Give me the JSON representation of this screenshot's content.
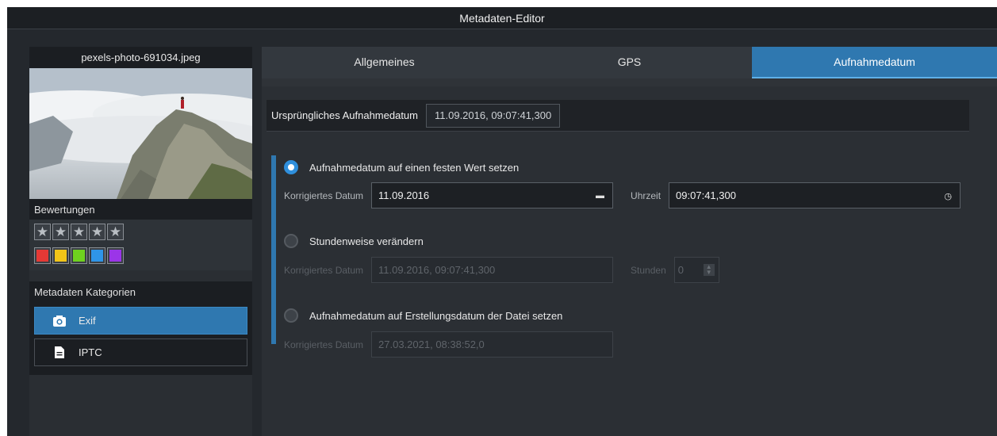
{
  "window": {
    "title": "Metadaten-Editor"
  },
  "left": {
    "filename": "pexels-photo-691034.jpeg",
    "ratings_label": "Bewertungen",
    "star_count": 5,
    "color_labels": [
      "#e53935",
      "#f2c518",
      "#6fd11f",
      "#2f95e8",
      "#9b35e8"
    ],
    "categories_label": "Metadaten Kategorien",
    "categories": [
      {
        "label": "Exif",
        "icon": "camera-icon",
        "active": true
      },
      {
        "label": "IPTC",
        "icon": "document-icon",
        "active": false
      }
    ]
  },
  "tabs": [
    {
      "label": "Allgemeines",
      "active": false
    },
    {
      "label": "GPS",
      "active": false
    },
    {
      "label": "Aufnahmedatum",
      "active": true
    }
  ],
  "original": {
    "label": "Ursprüngliches Aufnahmedatum",
    "value": "11.09.2016, 09:07:41,300"
  },
  "options": {
    "fixed": {
      "label": "Aufnahmedatum auf einen festen Wert setzen",
      "selected": true,
      "date_label": "Korrigiertes Datum",
      "date_value": "11.09.2016",
      "time_label": "Uhrzeit",
      "time_value": "09:07:41,300"
    },
    "hourly": {
      "label": "Stundenweise verändern",
      "selected": false,
      "date_label": "Korrigiertes Datum",
      "date_value": "11.09.2016, 09:07:41,300",
      "hours_label": "Stunden",
      "hours_value": "0"
    },
    "filedate": {
      "label": "Aufnahmedatum auf Erstellungsdatum der Datei setzen",
      "selected": false,
      "date_label": "Korrigiertes Datum",
      "date_value": "27.03.2021, 08:38:52,0"
    }
  },
  "colors": {
    "accent": "#2f78b0",
    "radio_on": "#2f8fdc"
  }
}
